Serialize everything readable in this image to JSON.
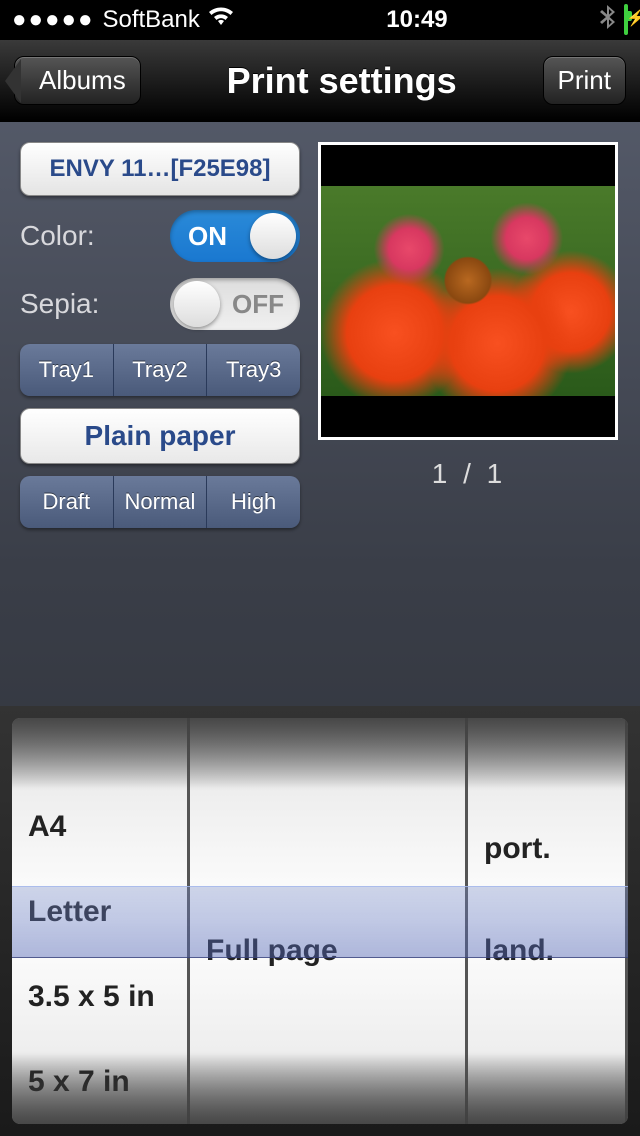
{
  "status": {
    "carrier": "SoftBank",
    "time": "10:49"
  },
  "nav": {
    "back": "Albums",
    "title": "Print settings",
    "action": "Print"
  },
  "printer": {
    "label": "ENVY 11…[F25E98]"
  },
  "toggles": {
    "color": {
      "label": "Color:",
      "state": "ON"
    },
    "sepia": {
      "label": "Sepia:",
      "state": "OFF"
    }
  },
  "trays": [
    "Tray1",
    "Tray2",
    "Tray3"
  ],
  "paper_type": "Plain paper",
  "quality": [
    "Draft",
    "Normal",
    "High"
  ],
  "page_counter": "1  /  1",
  "picker": {
    "size": [
      "A4",
      "Letter",
      "3.5 x 5 in",
      "5 x 7 in"
    ],
    "layout": [
      "Full page"
    ],
    "orient": [
      "port.",
      "land."
    ]
  }
}
